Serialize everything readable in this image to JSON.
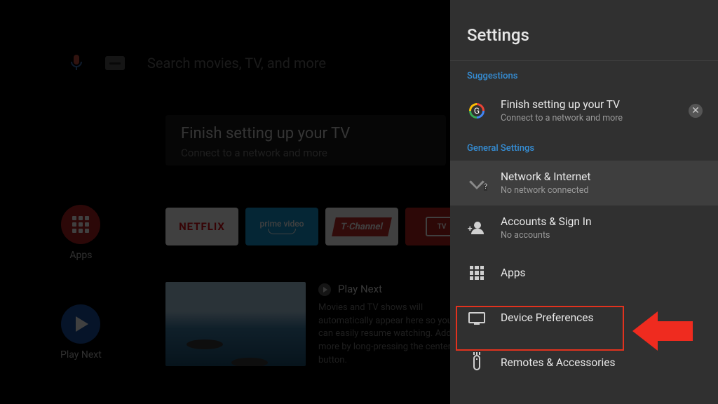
{
  "home": {
    "search_placeholder": "Search movies, TV, and more",
    "setup_card": {
      "title": "Finish setting up your TV",
      "subtitle": "Connect to a network and more"
    },
    "side": {
      "apps_label": "Apps",
      "playnext_label": "Play Next"
    },
    "apps": {
      "netflix": "NETFLIX",
      "prime": "prime video",
      "tchannel": "T·Channel",
      "live": "TV"
    },
    "playnext": {
      "title": "Play Next",
      "desc": "Movies and TV shows will automatically appear here so you can easily resume watching. Add more by long-pressing the center button."
    }
  },
  "panel": {
    "title": "Settings",
    "suggestions_hdr": "Suggestions",
    "suggestion": {
      "title": "Finish setting up your TV",
      "subtitle": "Connect to a network and more"
    },
    "general_hdr": "General Settings",
    "items": [
      {
        "title": "Network & Internet",
        "subtitle": "No network connected"
      },
      {
        "title": "Accounts & Sign In",
        "subtitle": "No accounts"
      },
      {
        "title": "Apps"
      },
      {
        "title": "Device Preferences"
      },
      {
        "title": "Remotes & Accessories"
      }
    ]
  }
}
